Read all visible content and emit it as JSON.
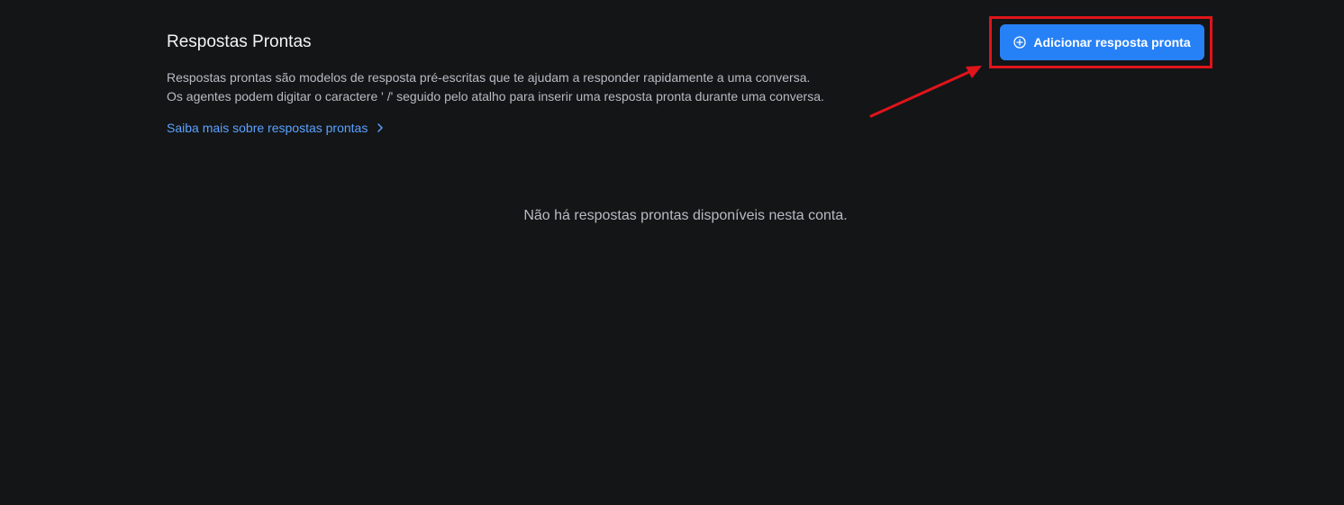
{
  "page": {
    "title": "Respostas Prontas",
    "description_line1": "Respostas prontas são modelos de resposta pré-escritas que te ajudam a responder rapidamente a uma conversa.",
    "description_line2": "Os agentes podem digitar o caractere ' /' seguido pelo atalho para inserir uma resposta pronta durante uma conversa.",
    "learn_more_label": "Saiba mais sobre respostas prontas",
    "empty_state": "Não há respostas prontas disponíveis nesta conta."
  },
  "toolbar": {
    "add_button_label": "Adicionar resposta pronta",
    "add_button_icon": "plus-circle-icon"
  },
  "annotation": {
    "highlight_color": "#e0141b",
    "arrow_color": "#e0141b"
  },
  "colors": {
    "background": "#141517",
    "accent": "#2781f6",
    "link": "#5aa2ff"
  }
}
